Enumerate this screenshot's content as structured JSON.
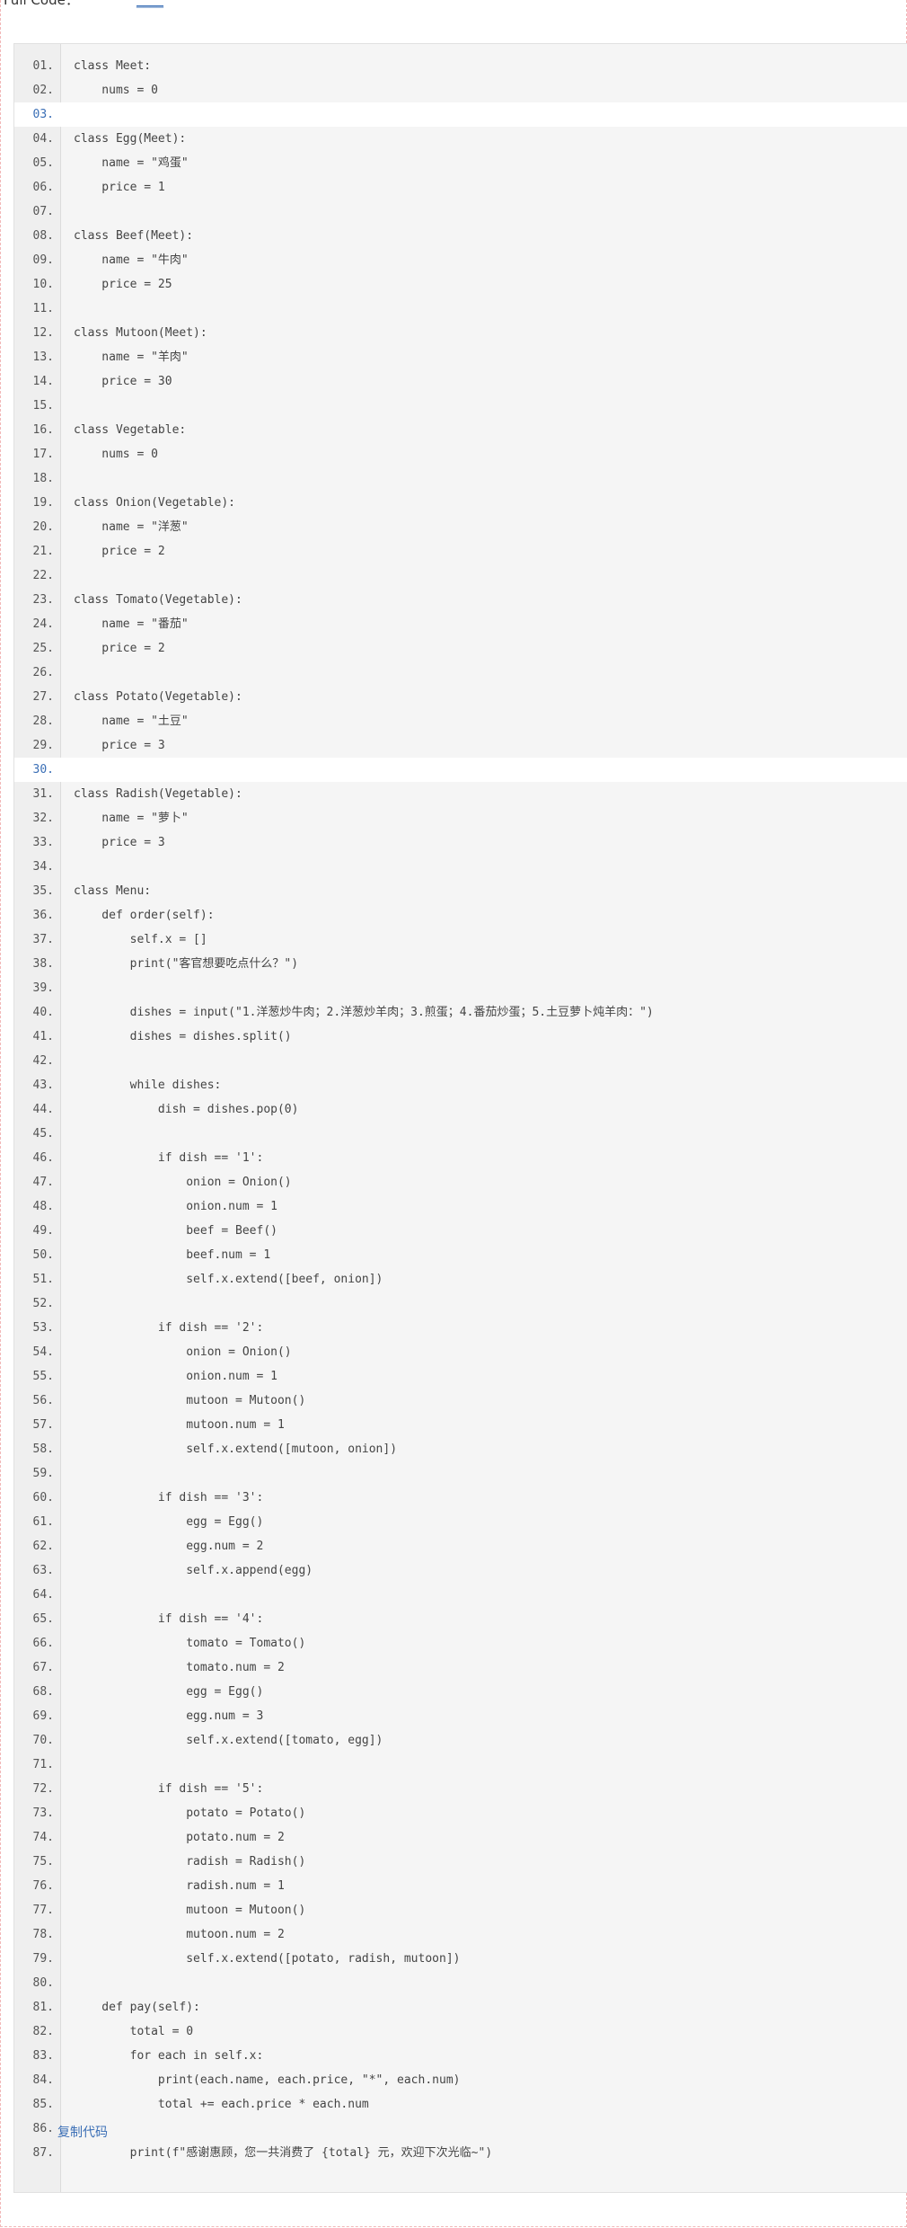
{
  "header": {
    "label": "Full Code：",
    "link_text": "____"
  },
  "code": {
    "lines": [
      {
        "n": "01.",
        "t": "class Meet:"
      },
      {
        "n": "02.",
        "t": "    nums = 0"
      },
      {
        "n": "03.",
        "t": ""
      },
      {
        "n": "04.",
        "t": "class Egg(Meet):"
      },
      {
        "n": "05.",
        "t": "    name = \"鸡蛋\""
      },
      {
        "n": "06.",
        "t": "    price = 1"
      },
      {
        "n": "07.",
        "t": ""
      },
      {
        "n": "08.",
        "t": "class Beef(Meet):"
      },
      {
        "n": "09.",
        "t": "    name = \"牛肉\""
      },
      {
        "n": "10.",
        "t": "    price = 25"
      },
      {
        "n": "11.",
        "t": ""
      },
      {
        "n": "12.",
        "t": "class Mutoon(Meet):"
      },
      {
        "n": "13.",
        "t": "    name = \"羊肉\""
      },
      {
        "n": "14.",
        "t": "    price = 30"
      },
      {
        "n": "15.",
        "t": ""
      },
      {
        "n": "16.",
        "t": "class Vegetable:"
      },
      {
        "n": "17.",
        "t": "    nums = 0"
      },
      {
        "n": "18.",
        "t": ""
      },
      {
        "n": "19.",
        "t": "class Onion(Vegetable):"
      },
      {
        "n": "20.",
        "t": "    name = \"洋葱\""
      },
      {
        "n": "21.",
        "t": "    price = 2"
      },
      {
        "n": "22.",
        "t": ""
      },
      {
        "n": "23.",
        "t": "class Tomato(Vegetable):"
      },
      {
        "n": "24.",
        "t": "    name = \"番茄\""
      },
      {
        "n": "25.",
        "t": "    price = 2"
      },
      {
        "n": "26.",
        "t": ""
      },
      {
        "n": "27.",
        "t": "class Potato(Vegetable):"
      },
      {
        "n": "28.",
        "t": "    name = \"土豆\""
      },
      {
        "n": "29.",
        "t": "    price = 3"
      },
      {
        "n": "30.",
        "t": ""
      },
      {
        "n": "31.",
        "t": "class Radish(Vegetable):"
      },
      {
        "n": "32.",
        "t": "    name = \"萝卜\""
      },
      {
        "n": "33.",
        "t": "    price = 3"
      },
      {
        "n": "34.",
        "t": ""
      },
      {
        "n": "35.",
        "t": "class Menu:"
      },
      {
        "n": "36.",
        "t": "    def order(self):"
      },
      {
        "n": "37.",
        "t": "        self.x = []"
      },
      {
        "n": "38.",
        "t": "        print(\"客官想要吃点什么？\")"
      },
      {
        "n": "39.",
        "t": ""
      },
      {
        "n": "40.",
        "t": "        dishes = input(\"1.洋葱炒牛肉；2.洋葱炒羊肉；3.煎蛋；4.番茄炒蛋；5.土豆萝卜炖羊肉：\")"
      },
      {
        "n": "41.",
        "t": "        dishes = dishes.split()"
      },
      {
        "n": "42.",
        "t": ""
      },
      {
        "n": "43.",
        "t": "        while dishes:"
      },
      {
        "n": "44.",
        "t": "            dish = dishes.pop(0)"
      },
      {
        "n": "45.",
        "t": ""
      },
      {
        "n": "46.",
        "t": "            if dish == '1':"
      },
      {
        "n": "47.",
        "t": "                onion = Onion()"
      },
      {
        "n": "48.",
        "t": "                onion.num = 1"
      },
      {
        "n": "49.",
        "t": "                beef = Beef()"
      },
      {
        "n": "50.",
        "t": "                beef.num = 1"
      },
      {
        "n": "51.",
        "t": "                self.x.extend([beef, onion])"
      },
      {
        "n": "52.",
        "t": ""
      },
      {
        "n": "53.",
        "t": "            if dish == '2':"
      },
      {
        "n": "54.",
        "t": "                onion = Onion()"
      },
      {
        "n": "55.",
        "t": "                onion.num = 1"
      },
      {
        "n": "56.",
        "t": "                mutoon = Mutoon()"
      },
      {
        "n": "57.",
        "t": "                mutoon.num = 1"
      },
      {
        "n": "58.",
        "t": "                self.x.extend([mutoon, onion])"
      },
      {
        "n": "59.",
        "t": ""
      },
      {
        "n": "60.",
        "t": "            if dish == '3':"
      },
      {
        "n": "61.",
        "t": "                egg = Egg()"
      },
      {
        "n": "62.",
        "t": "                egg.num = 2"
      },
      {
        "n": "63.",
        "t": "                self.x.append(egg)"
      },
      {
        "n": "64.",
        "t": ""
      },
      {
        "n": "65.",
        "t": "            if dish == '4':"
      },
      {
        "n": "66.",
        "t": "                tomato = Tomato()"
      },
      {
        "n": "67.",
        "t": "                tomato.num = 2"
      },
      {
        "n": "68.",
        "t": "                egg = Egg()"
      },
      {
        "n": "69.",
        "t": "                egg.num = 3"
      },
      {
        "n": "70.",
        "t": "                self.x.extend([tomato, egg])"
      },
      {
        "n": "71.",
        "t": ""
      },
      {
        "n": "72.",
        "t": "            if dish == '5':"
      },
      {
        "n": "73.",
        "t": "                potato = Potato()"
      },
      {
        "n": "74.",
        "t": "                potato.num = 2"
      },
      {
        "n": "75.",
        "t": "                radish = Radish()"
      },
      {
        "n": "76.",
        "t": "                radish.num = 1"
      },
      {
        "n": "77.",
        "t": "                mutoon = Mutoon()"
      },
      {
        "n": "78.",
        "t": "                mutoon.num = 2"
      },
      {
        "n": "79.",
        "t": "                self.x.extend([potato, radish, mutoon])"
      },
      {
        "n": "80.",
        "t": ""
      },
      {
        "n": "81.",
        "t": "    def pay(self):"
      },
      {
        "n": "82.",
        "t": "        total = 0"
      },
      {
        "n": "83.",
        "t": "        for each in self.x:"
      },
      {
        "n": "84.",
        "t": "            print(each.name, each.price, \"*\", each.num)"
      },
      {
        "n": "85.",
        "t": "            total += each.price * each.num"
      },
      {
        "n": "86.",
        "t": ""
      },
      {
        "n": "87.",
        "t": "        print(f\"感谢惠顾，您一共消费了 {total} 元，欢迎下次光临~\")"
      }
    ],
    "highlighted": [
      "03.",
      "30."
    ],
    "copy_label": "复制代码"
  }
}
